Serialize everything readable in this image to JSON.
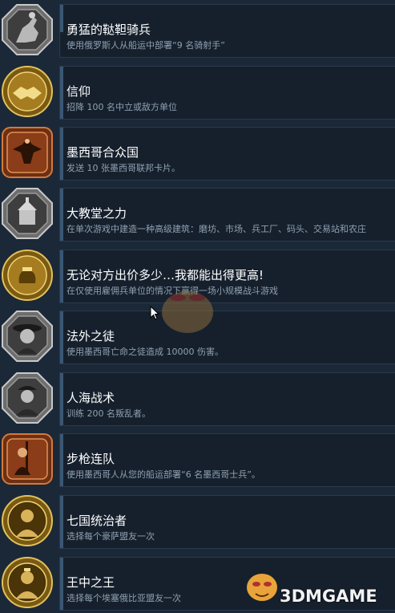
{
  "achievements": [
    {
      "icon": "cossack-rider-icon",
      "metal": "silver",
      "title": "勇猛的鞑靼骑兵",
      "desc": "使用俄罗斯人从船运中部署“9 名骑射手”"
    },
    {
      "icon": "handshake-icon",
      "metal": "gold",
      "title": "信仰",
      "desc": "招降 100 名中立或敌方单位"
    },
    {
      "icon": "eagle-icon",
      "metal": "bronze",
      "title": "墨西哥合众国",
      "desc": "发送 10 张墨西哥联邦卡片。"
    },
    {
      "icon": "cathedral-icon",
      "metal": "silver",
      "title": "大教堂之力",
      "desc": "在单次游戏中建造一种高级建筑：磨坊、市场、兵工厂、码头、交易站和农庄"
    },
    {
      "icon": "money-bag-icon",
      "metal": "gold",
      "title": "无论对方出价多少…我都能出得更高!",
      "desc": "在仅使用雇佣兵单位的情况下赢得一场小规模战斗游戏"
    },
    {
      "icon": "outlaw-icon",
      "metal": "silver",
      "title": "法外之徒",
      "desc": "使用墨西哥亡命之徒造成 10000 伤害。"
    },
    {
      "icon": "rebel-icon",
      "metal": "silver",
      "title": "人海战术",
      "desc": "训练 200 名叛乱者。"
    },
    {
      "icon": "rifleman-icon",
      "metal": "bronze",
      "title": "步枪连队",
      "desc": "使用墨西哥人从您的船运部署“6 名墨西哥士兵”。"
    },
    {
      "icon": "queen-portrait-icon",
      "metal": "gold",
      "title": "七国统治者",
      "desc": "选择每个豪萨盟友一次"
    },
    {
      "icon": "king-portrait-icon",
      "metal": "gold",
      "title": "王中之王",
      "desc": "选择每个埃塞俄比亚盟友一次"
    }
  ],
  "watermark": "3DMGAME",
  "colors": {
    "gold": "#b8912f",
    "silver": "#8c8c8c",
    "bronze": "#9b4a22"
  }
}
